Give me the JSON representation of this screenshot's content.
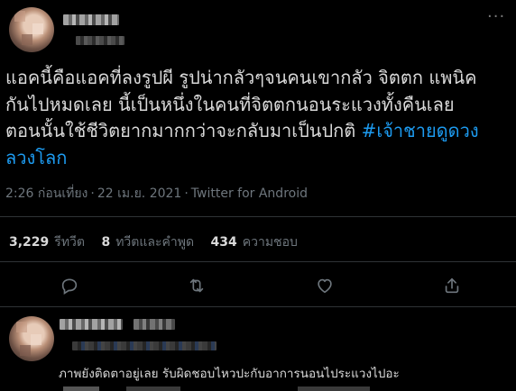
{
  "tweet": {
    "text_lines": [
      "แอคนี้คือแอคที่ลงรูปผี รูปน่ากลัวๆจนคนเขากลัว จิตตก แพนิค",
      "กันไปหมดเลย นี้เป็นหนึ่งในคนที่จิตตกนอนระแวงทั้งคืนเลย",
      "ตอนนั้นใช้ชีวิตยากมากกว่าจะกลับมาเป็นปกติ "
    ],
    "hashtag_part1": "#เจ้าชายดูดวง",
    "hashtag_part2": "ลวงโลก",
    "time": "2:26 ก่อนเที่ยง",
    "date": "22 เม.ย. 2021",
    "source": "Twitter for Android",
    "meta_separator": "·",
    "more_glyph": "···"
  },
  "stats": {
    "retweets_count": "3,229",
    "retweets_label": "รีทวีต",
    "quotes_count": "8",
    "quotes_label": "ทวีตและคำพูด",
    "likes_count": "434",
    "likes_label": "ความชอบ"
  },
  "reply": {
    "text": "ภาพยังติดตาอยู่เลย รับผิดชอบไหวปะกับอาการนอนไประแวงไปอะ"
  },
  "colors": {
    "background": "#000000",
    "text": "#d9d9d9",
    "secondary": "#6e767d",
    "accent": "#1d9bf0",
    "divider": "#2f3336"
  }
}
